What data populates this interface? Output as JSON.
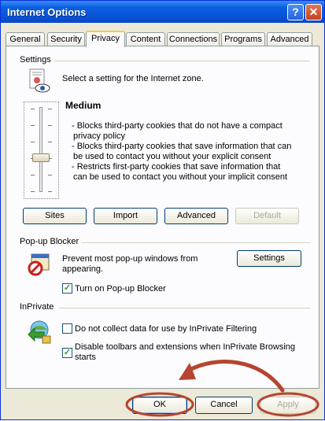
{
  "window": {
    "title": "Internet Options"
  },
  "tabs": [
    {
      "label": "General"
    },
    {
      "label": "Security"
    },
    {
      "label": "Privacy"
    },
    {
      "label": "Content"
    },
    {
      "label": "Connections"
    },
    {
      "label": "Programs"
    },
    {
      "label": "Advanced"
    }
  ],
  "settings": {
    "label": "Settings",
    "description": "Select a setting for the Internet zone.",
    "level": "Medium",
    "bullets": [
      "- Blocks third-party cookies that do not have a compact",
      "privacy policy",
      "- Blocks third-party cookies that save information that can",
      "be used to contact you without your explicit consent",
      "- Restricts first-party cookies that save information that",
      "can be used to contact you without your implicit consent"
    ],
    "buttons": {
      "sites": "Sites",
      "import": "Import",
      "advanced": "Advanced",
      "default": "Default"
    }
  },
  "popup": {
    "label": "Pop-up Blocker",
    "description_line1": "Prevent most pop-up windows from",
    "description_line2": "appearing.",
    "settings_button": "Settings",
    "checkbox_label": "Turn on Pop-up Blocker",
    "checked": true
  },
  "inprivate": {
    "label": "InPrivate",
    "option1": "Do not collect data for use by InPrivate Filtering",
    "option1_checked": false,
    "option2_line1": "Disable toolbars and extensions when InPrivate Browsing",
    "option2_line2": "starts",
    "option2_checked": true
  },
  "footer": {
    "ok": "OK",
    "cancel": "Cancel",
    "apply": "Apply"
  },
  "colors": {
    "titlebar": "#0a54d8",
    "annotation": "#b5452f"
  }
}
